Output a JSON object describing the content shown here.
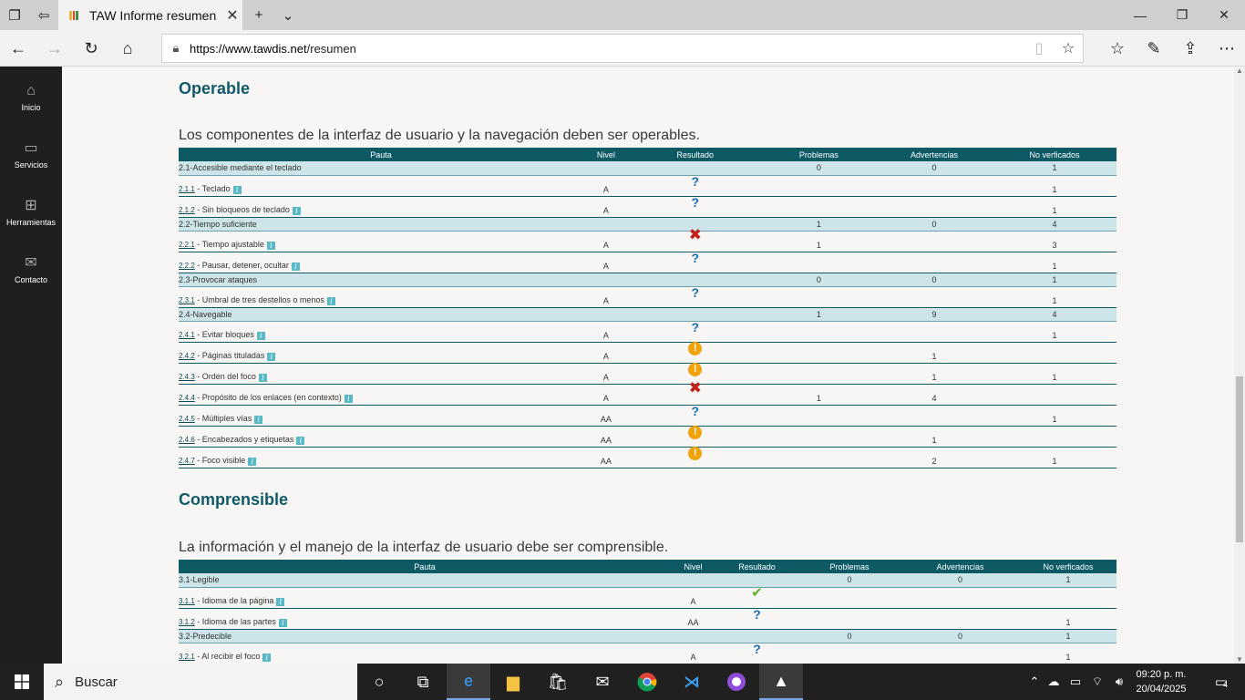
{
  "browser": {
    "tab_title": "TAW Informe resumen",
    "url_host": "https://www.tawdis.net",
    "url_path": "/resumen"
  },
  "sidebar": [
    {
      "label": "Inicio",
      "icon": "home-icon"
    },
    {
      "label": "Servicios",
      "icon": "briefcase-icon"
    },
    {
      "label": "Herramientas",
      "icon": "grid-icon"
    },
    {
      "label": "Contacto",
      "icon": "mail-icon"
    }
  ],
  "operable": {
    "heading": "Operable",
    "lead": "Los componentes de la interfaz de usuario y la navegación deben ser operables.",
    "headers": [
      "Pauta",
      "Nivel",
      "Resultado",
      "Problemas",
      "Advertencias",
      "No verficados"
    ],
    "rows": [
      {
        "type": "grp",
        "label": "2.1-Accesible mediante el teclado",
        "prob": "0",
        "adv": "0",
        "nover": "1"
      },
      {
        "type": "row",
        "code": "2.1.1",
        "name": " - Teclado",
        "level": "A",
        "res": "?",
        "prob": "",
        "adv": "",
        "nover": "1"
      },
      {
        "type": "row",
        "code": "2.1.2",
        "name": " - Sin bloqueos de teclado",
        "level": "A",
        "res": "?",
        "prob": "",
        "adv": "",
        "nover": "1"
      },
      {
        "type": "grp",
        "label": "2.2-Tiempo suficiente",
        "prob": "1",
        "adv": "0",
        "nover": "4"
      },
      {
        "type": "row",
        "code": "2.2.1",
        "name": " - Tiempo ajustable",
        "level": "A",
        "res": "✖",
        "prob": "1",
        "adv": "",
        "nover": "3"
      },
      {
        "type": "row",
        "code": "2.2.2",
        "name": " - Pausar, detener, ocultar",
        "level": "A",
        "res": "?",
        "prob": "",
        "adv": "",
        "nover": "1"
      },
      {
        "type": "grp",
        "label": "2.3-Provocar ataques",
        "prob": "0",
        "adv": "0",
        "nover": "1"
      },
      {
        "type": "row",
        "code": "2.3.1",
        "name": " - Umbral de tres destellos o menos",
        "level": "A",
        "res": "?",
        "prob": "",
        "adv": "",
        "nover": "1"
      },
      {
        "type": "grp",
        "label": "2.4-Navegable",
        "prob": "1",
        "adv": "9",
        "nover": "4"
      },
      {
        "type": "row",
        "code": "2.4.1",
        "name": " - Evitar bloques",
        "level": "A",
        "res": "?",
        "prob": "",
        "adv": "",
        "nover": "1"
      },
      {
        "type": "row",
        "code": "2.4.2",
        "name": " - Páginas tituladas",
        "level": "A",
        "res": "!",
        "prob": "",
        "adv": "1",
        "nover": ""
      },
      {
        "type": "row",
        "code": "2.4.3",
        "name": " - Orden del foco",
        "level": "A",
        "res": "!",
        "prob": "",
        "adv": "1",
        "nover": "1"
      },
      {
        "type": "row",
        "code": "2.4.4",
        "name": " - Propósito de los enlaces (en contexto)",
        "level": "A",
        "res": "✖",
        "prob": "1",
        "adv": "4",
        "nover": ""
      },
      {
        "type": "row",
        "code": "2.4.5",
        "name": " - Múltiples vías",
        "level": "AA",
        "res": "?",
        "prob": "",
        "adv": "",
        "nover": "1"
      },
      {
        "type": "row",
        "code": "2.4.6",
        "name": " - Encabezados y etiquetas",
        "level": "AA",
        "res": "!",
        "prob": "",
        "adv": "1",
        "nover": ""
      },
      {
        "type": "row",
        "code": "2.4.7",
        "name": " - Foco visible",
        "level": "AA",
        "res": "!",
        "prob": "",
        "adv": "2",
        "nover": "1"
      }
    ]
  },
  "comprensible": {
    "heading": "Comprensible",
    "lead": "La información y el manejo de la interfaz de usuario debe ser comprensible.",
    "headers": [
      "Pauta",
      "Nivel",
      "Resultado",
      "Problemas",
      "Advertencias",
      "No verficados"
    ],
    "rows": [
      {
        "type": "grp",
        "label": "3.1-Legible",
        "prob": "0",
        "adv": "0",
        "nover": "1"
      },
      {
        "type": "row",
        "code": "3.1.1",
        "name": " - Idioma de la página",
        "level": "A",
        "res": "✔",
        "prob": "",
        "adv": "",
        "nover": ""
      },
      {
        "type": "row",
        "code": "3.1.2",
        "name": " - Idioma de las partes",
        "level": "AA",
        "res": "?",
        "prob": "",
        "adv": "",
        "nover": "1"
      },
      {
        "type": "grp",
        "label": "3.2-Predecible",
        "prob": "0",
        "adv": "0",
        "nover": "1"
      },
      {
        "type": "row",
        "code": "3.2.1",
        "name": " - Al recibir el foco",
        "level": "A",
        "res": "?",
        "prob": "",
        "adv": "",
        "nover": "1"
      }
    ]
  },
  "info_glyph": "i",
  "taskbar": {
    "search_placeholder": "Buscar",
    "time": "09:20 p. m.",
    "date": "20/04/2025",
    "notifications": "4"
  }
}
